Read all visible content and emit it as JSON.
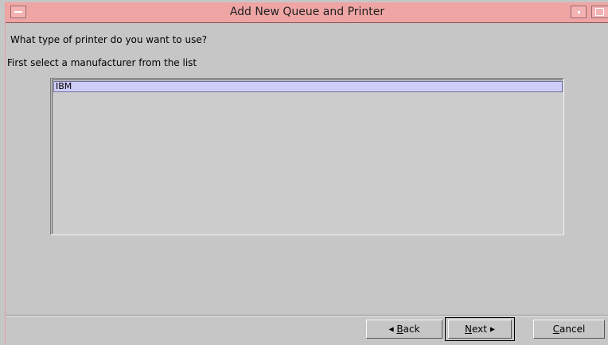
{
  "window": {
    "title": "Add New Queue and Printer"
  },
  "prompt": {
    "question": "What type of printer do you want to use?",
    "instruction": "First select a manufacturer from the list"
  },
  "manufacturers": {
    "items": [
      "IBM"
    ],
    "selected": "IBM"
  },
  "buttons": {
    "back_mnemonic": "B",
    "back_rest": "ack",
    "next_mnemonic": "N",
    "next_rest": "ext",
    "cancel_mnemonic": "C",
    "cancel_rest": "ancel"
  },
  "icons": {
    "back": "triangle-left-icon",
    "next": "triangle-right-icon"
  },
  "colors": {
    "titlebar": "#f0a5a5",
    "selection": "#cdcdf8",
    "background": "#c6c6c6"
  }
}
